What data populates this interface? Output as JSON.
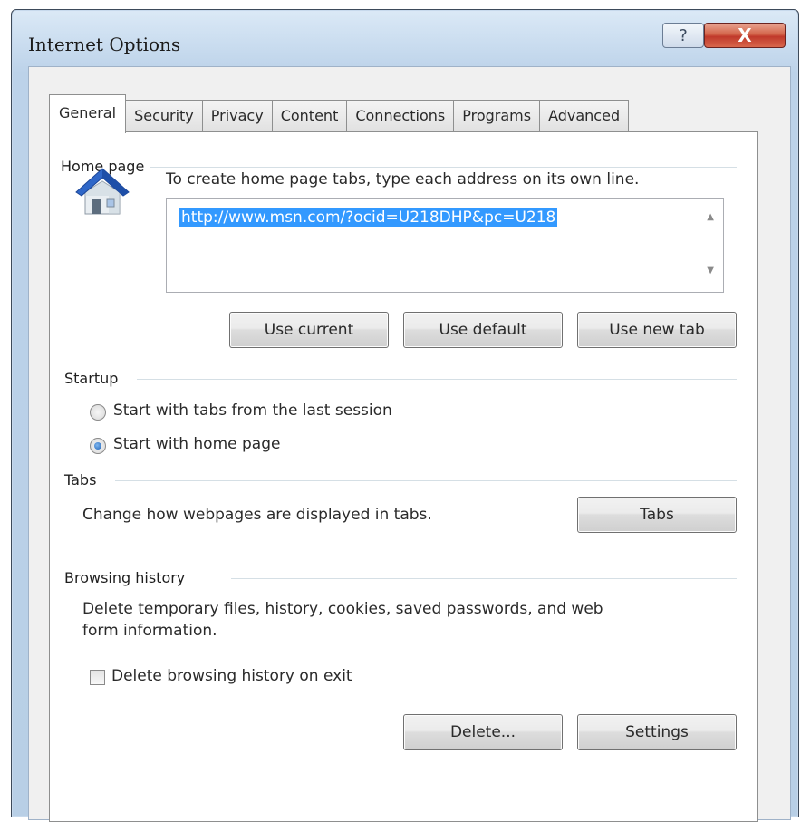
{
  "window": {
    "title": "Internet Options"
  },
  "titlebar": {
    "help_glyph": "?",
    "close_glyph": "X"
  },
  "tabs": [
    {
      "label": "General",
      "active": true
    },
    {
      "label": "Security"
    },
    {
      "label": "Privacy"
    },
    {
      "label": "Content"
    },
    {
      "label": "Connections"
    },
    {
      "label": "Programs"
    },
    {
      "label": "Advanced"
    }
  ],
  "home_page": {
    "heading": "Home page",
    "instruction": "To create home page tabs, type each address on its own line.",
    "url": "http://www.msn.com/?ocid=U218DHP&pc=U218",
    "buttons": {
      "use_current": "Use current",
      "use_default": "Use default",
      "use_new_tab": "Use new tab"
    }
  },
  "startup": {
    "heading": "Startup",
    "option_last_session": "Start with tabs from the last session",
    "option_home_page": "Start with home page",
    "selected": "Start with home page"
  },
  "tabs_section": {
    "heading": "Tabs",
    "description": "Change how webpages are displayed in tabs.",
    "button": "Tabs"
  },
  "browsing_history": {
    "heading": "Browsing history",
    "description_line1": "Delete temporary files, history, cookies, saved passwords, and web",
    "description_line2": "form information.",
    "delete_on_exit_label": "Delete browsing history on exit",
    "delete_on_exit_checked": false,
    "delete_button": "Delete...",
    "settings_button": "Settings"
  },
  "icons": {
    "house": "home-icon",
    "close": "close-icon",
    "help": "help-icon"
  },
  "colors": {
    "selection": "#3399ff",
    "close_button": "#c0392b",
    "frame": "#bcd2e9"
  }
}
